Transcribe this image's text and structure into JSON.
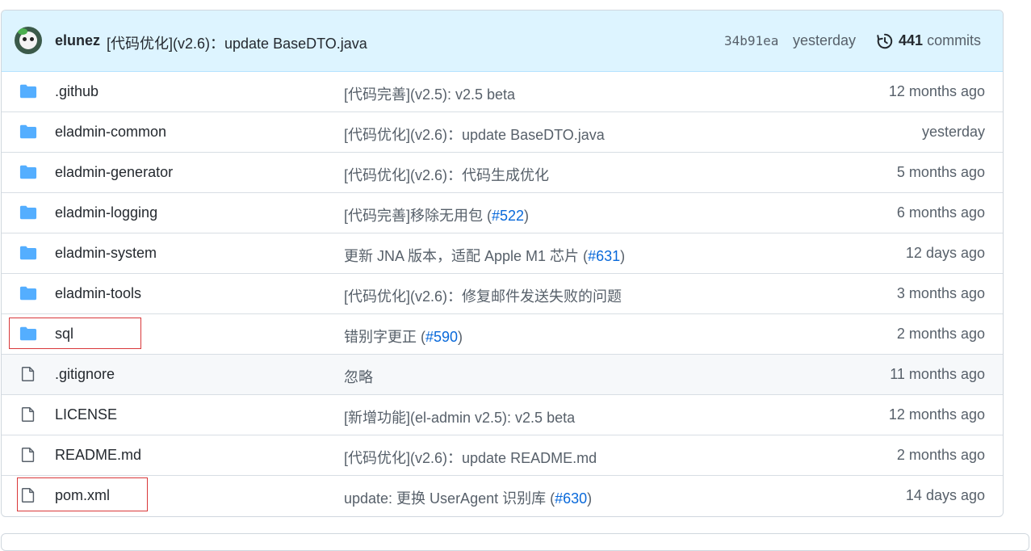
{
  "commit": {
    "author": "elunez",
    "message": "[代码优化](v2.6)：update BaseDTO.java",
    "sha": "34b91ea",
    "time": "yesterday",
    "commit_count": "441",
    "commits_label": "commits"
  },
  "rows": [
    {
      "type": "folder",
      "name": ".github",
      "msg": "[代码完善](v2.5): v2.5 beta",
      "link": "",
      "msg_suffix": "",
      "age": "12 months ago"
    },
    {
      "type": "folder",
      "name": "eladmin-common",
      "msg": "[代码优化](v2.6)：update BaseDTO.java",
      "link": "",
      "msg_suffix": "",
      "age": "yesterday"
    },
    {
      "type": "folder",
      "name": "eladmin-generator",
      "msg": "[代码优化](v2.6)：代码生成优化",
      "link": "",
      "msg_suffix": "",
      "age": "5 months ago"
    },
    {
      "type": "folder",
      "name": "eladmin-logging",
      "msg": "[代码完善]移除无用包 (",
      "link": "#522",
      "msg_suffix": ")",
      "age": "6 months ago"
    },
    {
      "type": "folder",
      "name": "eladmin-system",
      "msg": "更新 JNA 版本，适配 Apple M1 芯片 (",
      "link": "#631",
      "msg_suffix": ")",
      "age": "12 days ago"
    },
    {
      "type": "folder",
      "name": "eladmin-tools",
      "msg": "[代码优化](v2.6)：修复邮件发送失败的问题",
      "link": "",
      "msg_suffix": "",
      "age": "3 months ago"
    },
    {
      "type": "folder",
      "name": "sql",
      "msg": "错别字更正 (",
      "link": "#590",
      "msg_suffix": ")",
      "age": "2 months ago"
    },
    {
      "type": "file",
      "name": ".gitignore",
      "msg": "忽略",
      "link": "",
      "msg_suffix": "",
      "age": "11 months ago"
    },
    {
      "type": "file",
      "name": "LICENSE",
      "msg": "[新增功能](el-admin v2.5): v2.5 beta",
      "link": "",
      "msg_suffix": "",
      "age": "12 months ago"
    },
    {
      "type": "file",
      "name": "README.md",
      "msg": "[代码优化](v2.6)：update README.md",
      "link": "",
      "msg_suffix": "",
      "age": "2 months ago"
    },
    {
      "type": "file",
      "name": "pom.xml",
      "msg": "update: 更换 UserAgent 识别库 (",
      "link": "#630",
      "msg_suffix": ")",
      "age": "14 days ago"
    }
  ],
  "colors": {
    "folder": "#54aeff",
    "file": "#57606a",
    "link": "#0969da",
    "highlight": "#d9383a"
  }
}
